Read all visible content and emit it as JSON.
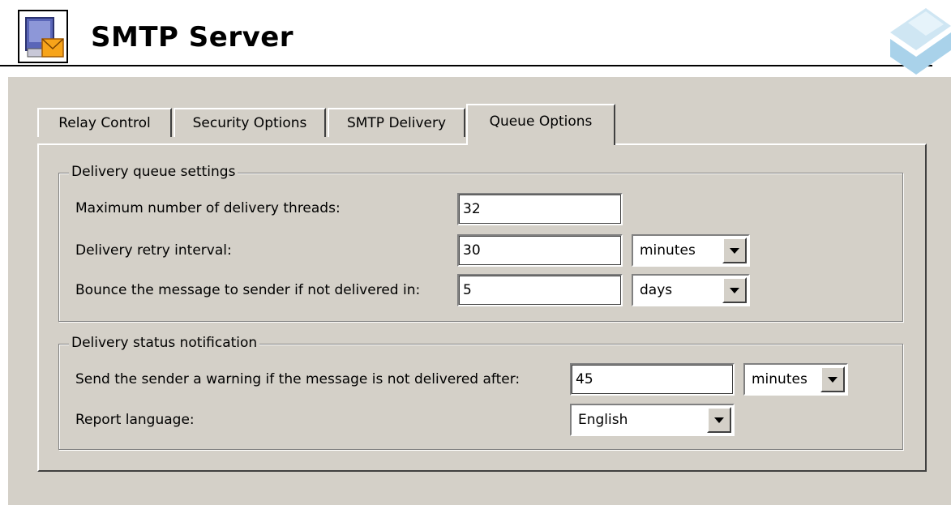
{
  "header": {
    "title": "SMTP Server"
  },
  "tabs": [
    {
      "label": "Relay Control"
    },
    {
      "label": "Security Options"
    },
    {
      "label": "SMTP Delivery"
    },
    {
      "label": "Queue Options"
    }
  ],
  "active_tab": "Queue Options",
  "queue_settings": {
    "legend": "Delivery queue settings",
    "max_threads_label": "Maximum number of delivery threads:",
    "max_threads_value": "32",
    "retry_label": "Delivery retry interval:",
    "retry_value": "30",
    "retry_unit": "minutes",
    "bounce_label": "Bounce the message to sender if not delivered in:",
    "bounce_value": "5",
    "bounce_unit": "days"
  },
  "status_notification": {
    "legend": "Delivery status notification",
    "warning_label": "Send the sender a warning if the message is not delivered after:",
    "warning_value": "45",
    "warning_unit": "minutes",
    "language_label": "Report language:",
    "language_value": "English"
  }
}
